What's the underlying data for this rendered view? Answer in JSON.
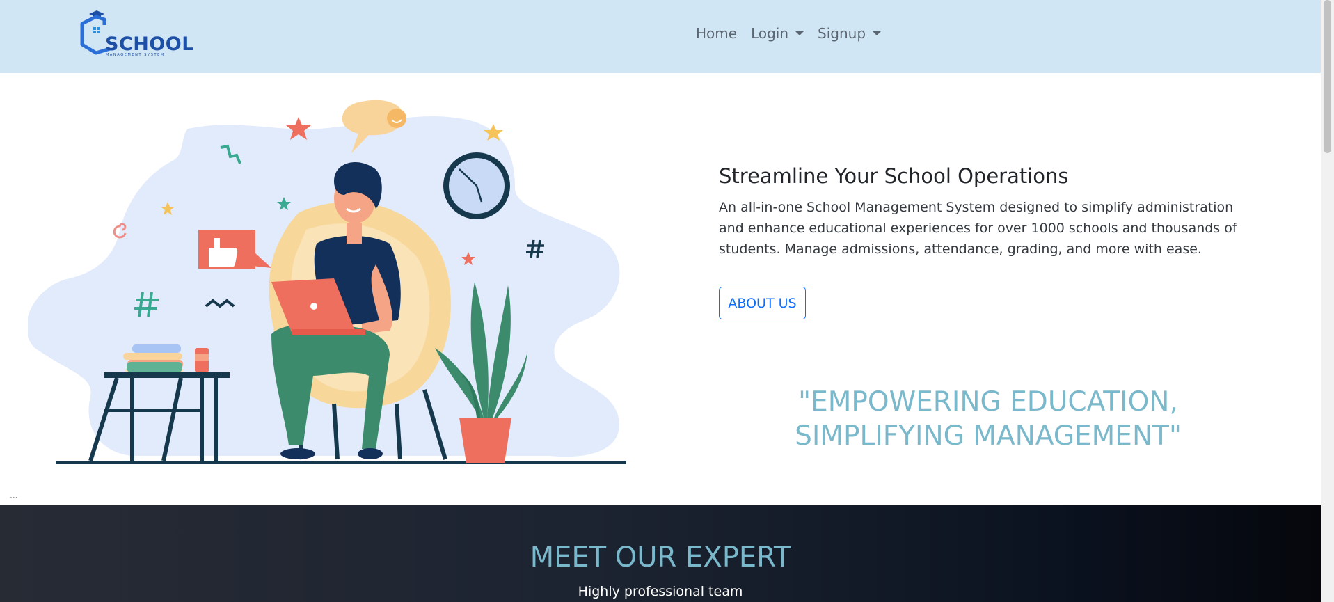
{
  "logo": {
    "text": "SCHOOL",
    "subtext": "MANAGEMENT SYSTEM"
  },
  "nav": {
    "items": [
      {
        "label": "Home",
        "dropdown": false
      },
      {
        "label": "Login",
        "dropdown": true
      },
      {
        "label": "Signup",
        "dropdown": true
      }
    ]
  },
  "hero": {
    "title": "Streamline Your School Operations",
    "description": "An all-in-one School Management System designed to simplify administration and enhance educational experiences for over 1000 schools and thousands of students. Manage admissions, attendance, grading, and more with ease.",
    "button_label": "ABOUT US",
    "quote": "\"EMPOWERING EDUCATION, SIMPLIFYING MANAGEMENT\""
  },
  "misc": {
    "ellipsis": "..."
  },
  "experts": {
    "title": "MEET OUR EXPERT",
    "subtitle": "Highly professional team"
  },
  "colors": {
    "navbar_bg": "#d0e6f5",
    "brand_blue": "#1d4fa6",
    "accent_teal": "#7ab8cc",
    "button_blue": "#0d6efd"
  }
}
